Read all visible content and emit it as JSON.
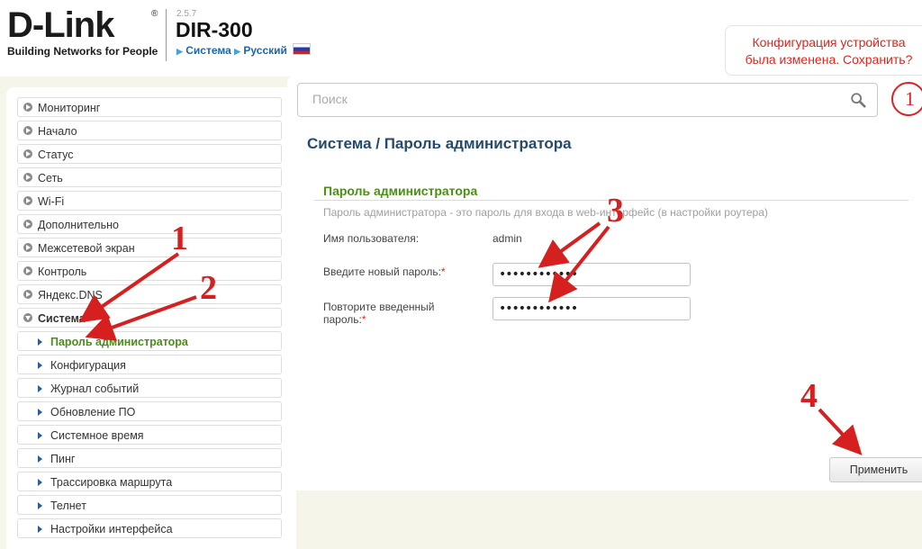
{
  "header": {
    "logo": "D-Link",
    "logo_reg": "®",
    "tagline": "Building Networks for People",
    "firmware": "2.5.7",
    "model": "DIR-300",
    "crumb_system": "Система",
    "crumb_language": "Русский"
  },
  "notice": {
    "line1": "Конфигурация устройства",
    "line2": "была изменена. Сохранить?"
  },
  "sidebar": {
    "items": [
      {
        "label": "Мониторинг"
      },
      {
        "label": "Начало"
      },
      {
        "label": "Статус"
      },
      {
        "label": "Сеть"
      },
      {
        "label": "Wi-Fi"
      },
      {
        "label": "Дополнительно"
      },
      {
        "label": "Межсетевой экран"
      },
      {
        "label": "Контроль"
      },
      {
        "label": "Яндекс.DNS"
      },
      {
        "label": "Система"
      }
    ],
    "subitems": [
      {
        "label": "Пароль администратора"
      },
      {
        "label": "Конфигурация"
      },
      {
        "label": "Журнал событий"
      },
      {
        "label": "Обновление ПО"
      },
      {
        "label": "Системное время"
      },
      {
        "label": "Пинг"
      },
      {
        "label": "Трассировка маршрута"
      },
      {
        "label": "Телнет"
      },
      {
        "label": "Настройки интерфейса"
      }
    ]
  },
  "search": {
    "placeholder": "Поиск",
    "value": ""
  },
  "page": {
    "title": "Система /  Пароль администратора",
    "section_title": "Пароль администратора",
    "section_desc": "Пароль администратора - это пароль для входа в web-интерфейс (в настройки роутера)",
    "username_label": "Имя пользователя:",
    "username_value": "admin",
    "new_password_label": "Введите новый пароль:",
    "new_password_value": "••••••••••••",
    "repeat_label_line1": "Повторите введенный",
    "repeat_label_line2": "пароль:",
    "repeat_password_value": "••••••••••••",
    "required_mark": "*",
    "apply_label": "Применить"
  },
  "badge": "1",
  "annotations": {
    "a1": "1",
    "a2": "2",
    "a3": "3",
    "a4": "4"
  },
  "colors": {
    "accent_red": "#d61f1f",
    "link_blue": "#1d66a8",
    "active_green": "#4a8f16",
    "title_blue": "#254a6b"
  }
}
